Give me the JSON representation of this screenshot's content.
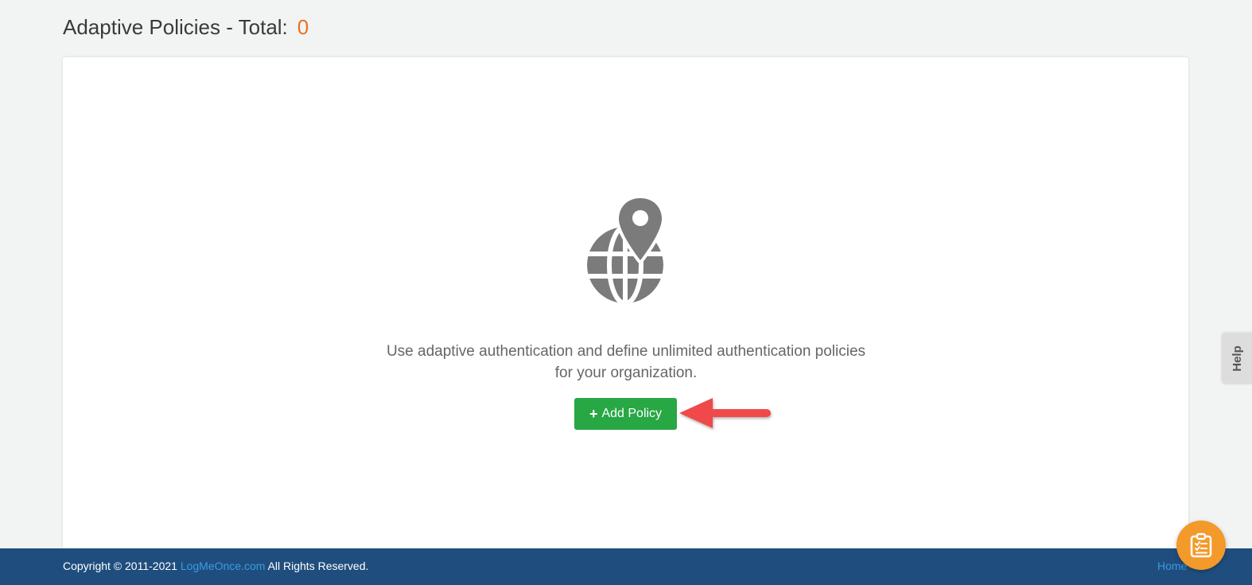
{
  "header": {
    "title": "Adaptive Policies - Total:",
    "total": "0"
  },
  "empty_state": {
    "icon": "globe-location-pin-icon",
    "message_line1": "Use adaptive authentication and define unlimited authentication policies",
    "message_line2": "for your organization.",
    "add_button_plus": "+",
    "add_button_label": "Add Policy"
  },
  "help_tab": {
    "label": "Help"
  },
  "footer": {
    "copyright_prefix": "Copyright © 2011-2021",
    "brand_link": "LogMeOnce.com",
    "copyright_suffix": "All Rights Reserved.",
    "home_link": "Home"
  },
  "fab": {
    "icon": "clipboard-checklist-icon"
  },
  "colors": {
    "accent_orange": "#e8731e",
    "button_green": "#28a745",
    "footer_blue": "#1f4e7e",
    "link_blue": "#3b9be0",
    "fab_orange": "#f39a2a",
    "arrow_red": "#f04848"
  }
}
